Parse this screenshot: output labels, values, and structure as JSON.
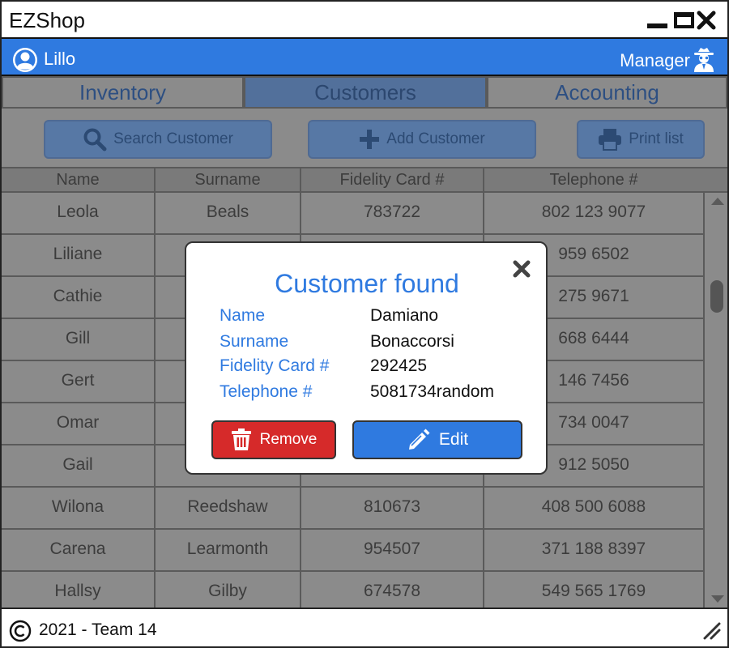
{
  "window": {
    "title": "EZShop"
  },
  "userbar": {
    "user_name": "Lillo",
    "role": "Manager"
  },
  "tabs": [
    {
      "label": "Inventory",
      "active": false
    },
    {
      "label": "Customers",
      "active": true
    },
    {
      "label": "Accounting",
      "active": false
    }
  ],
  "toolbar": {
    "search_label": "Search Customer",
    "add_label": "Add Customer",
    "print_label": "Print list"
  },
  "table": {
    "columns": [
      "Name",
      "Surname",
      "Fidelity Card #",
      "Telephone #"
    ],
    "rows": [
      {
        "name": "Leola",
        "surname": "Beals",
        "card": "783722",
        "phone": "802 123 9077"
      },
      {
        "name": "Liliane",
        "surname": "",
        "card": "",
        "phone": "959 6502"
      },
      {
        "name": "Cathie",
        "surname": "",
        "card": "",
        "phone": "275 9671"
      },
      {
        "name": "Gill",
        "surname": "",
        "card": "",
        "phone": "668 6444"
      },
      {
        "name": "Gert",
        "surname": "",
        "card": "",
        "phone": "146 7456"
      },
      {
        "name": "Omar",
        "surname": "",
        "card": "",
        "phone": "734 0047"
      },
      {
        "name": "Gail",
        "surname": "",
        "card": "",
        "phone": "912 5050"
      },
      {
        "name": "Wilona",
        "surname": "Reedshaw",
        "card": "810673",
        "phone": "408 500 6088"
      },
      {
        "name": "Carena",
        "surname": "Learmonth",
        "card": "954507",
        "phone": "371 188 8397"
      },
      {
        "name": "Hallsy",
        "surname": "Gilby",
        "card": "674578",
        "phone": "549 565 1769"
      }
    ]
  },
  "modal": {
    "title": "Customer found",
    "fields": [
      {
        "label": "Name",
        "value": "Damiano"
      },
      {
        "label": "Surname",
        "value": "Bonaccorsi"
      },
      {
        "label": "Fidelity Card #",
        "value": "292425"
      },
      {
        "label": "Telephone #",
        "value": "5081734random"
      }
    ],
    "remove_label": "Remove",
    "edit_label": "Edit"
  },
  "footer": {
    "text": "2021 - Team 14"
  },
  "colors": {
    "accent": "#2f7ae0",
    "danger": "#d62a2a",
    "dim": "#8b8b8b"
  }
}
